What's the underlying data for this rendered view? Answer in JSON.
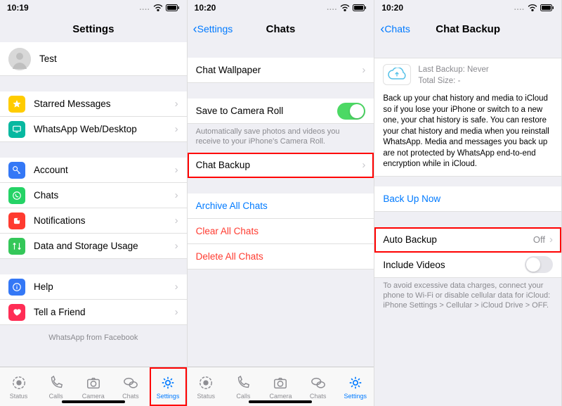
{
  "pane1": {
    "time": "10:19",
    "title": "Settings",
    "profileName": "Test",
    "rows": {
      "starred": "Starred Messages",
      "webdesktop": "WhatsApp Web/Desktop",
      "account": "Account",
      "chats": "Chats",
      "notifications": "Notifications",
      "storage": "Data and Storage Usage",
      "help": "Help",
      "tell": "Tell a Friend"
    },
    "footer": "WhatsApp from Facebook",
    "tabs": {
      "status": "Status",
      "calls": "Calls",
      "camera": "Camera",
      "chats": "Chats",
      "settings": "Settings"
    }
  },
  "pane2": {
    "time": "10:20",
    "back": "Settings",
    "title": "Chats",
    "rows": {
      "wallpaper": "Chat Wallpaper",
      "cameraRoll": "Save to Camera Roll",
      "chatBackup": "Chat Backup",
      "archive": "Archive All Chats",
      "clear": "Clear All Chats",
      "delete": "Delete All Chats"
    },
    "cameraNote": "Automatically save photos and videos you receive to your iPhone's Camera Roll.",
    "tabs": {
      "status": "Status",
      "calls": "Calls",
      "camera": "Camera",
      "chats": "Chats",
      "settings": "Settings"
    }
  },
  "pane3": {
    "time": "10:20",
    "back": "Chats",
    "title": "Chat Backup",
    "lastBackupLabel": "Last Backup:",
    "lastBackupValue": "Never",
    "totalSizeLabel": "Total Size:",
    "totalSizeValue": "-",
    "desc": "Back up your chat history and media to iCloud so if you lose your iPhone or switch to a new one, your chat history is safe. You can restore your chat history and media when you reinstall WhatsApp. Media and messages you back up are not protected by WhatsApp end-to-end encryption while in iCloud.",
    "backUpNow": "Back Up Now",
    "autoBackup": "Auto Backup",
    "autoBackupValue": "Off",
    "includeVideos": "Include Videos",
    "note": "To avoid excessive data charges, connect your phone to Wi-Fi or disable cellular data for iCloud: iPhone Settings > Cellular > iCloud Drive > OFF."
  }
}
